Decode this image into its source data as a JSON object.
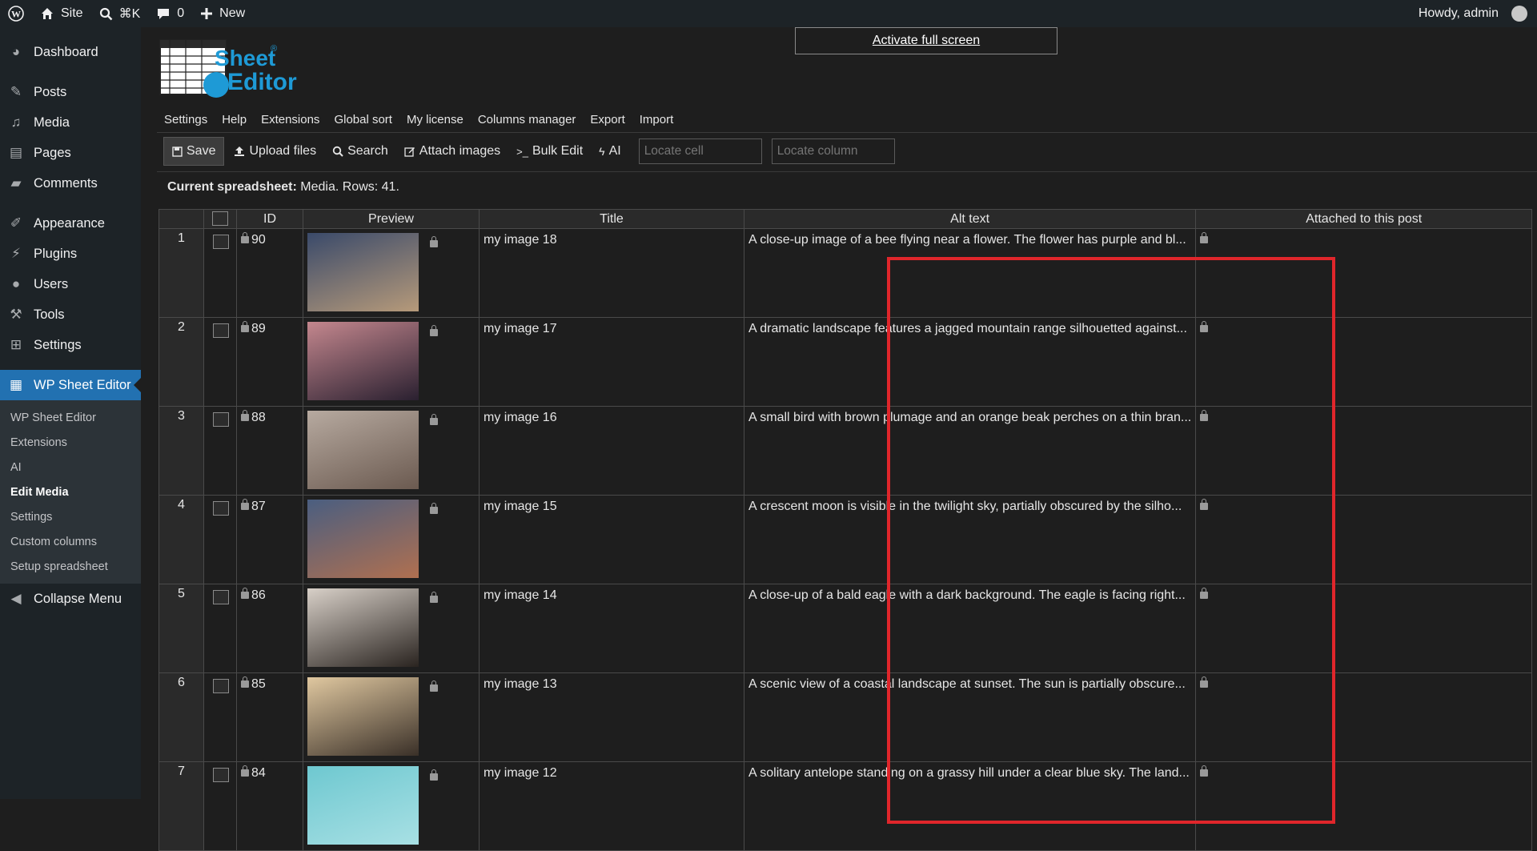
{
  "adminbar": {
    "site_label": "Site",
    "search_shortcut": "⌘K",
    "comments_count": "0",
    "new_label": "New",
    "greeting": "Howdy, admin"
  },
  "sidebar": {
    "items": [
      {
        "label": "Dashboard",
        "icon": "dashboard-icon"
      },
      {
        "label": "Posts",
        "icon": "pin-icon"
      },
      {
        "label": "Media",
        "icon": "media-icon"
      },
      {
        "label": "Pages",
        "icon": "pages-icon"
      },
      {
        "label": "Comments",
        "icon": "comment-icon"
      },
      {
        "label": "Appearance",
        "icon": "brush-icon"
      },
      {
        "label": "Plugins",
        "icon": "plug-icon"
      },
      {
        "label": "Users",
        "icon": "user-icon"
      },
      {
        "label": "Tools",
        "icon": "wrench-icon"
      },
      {
        "label": "Settings",
        "icon": "settings-icon"
      },
      {
        "label": "WP Sheet Editor",
        "icon": "sheet-icon"
      }
    ],
    "submenu": [
      "WP Sheet Editor",
      "Extensions",
      "AI",
      "Edit Media",
      "Settings",
      "Custom columns",
      "Setup spreadsheet"
    ],
    "collapse_label": "Collapse Menu"
  },
  "header": {
    "logo_text_top": "Sheet",
    "logo_text_bottom": "Editor",
    "logo_mark": "®",
    "fullscreen_label": "Activate full screen"
  },
  "topnav": [
    "Settings",
    "Help",
    "Extensions",
    "Global sort",
    "My license",
    "Columns manager",
    "Export",
    "Import"
  ],
  "toolbar": {
    "save": "Save",
    "upload": "Upload files",
    "search": "Search",
    "attach": "Attach images",
    "bulk": "Bulk Edit",
    "ai": "AI",
    "locate_cell_placeholder": "Locate cell",
    "locate_column_placeholder": "Locate column"
  },
  "status": {
    "prefix": "Current spreadsheet:",
    "text": "Media. Rows: 41."
  },
  "grid": {
    "headers": [
      "",
      "",
      "ID",
      "Preview",
      "Title",
      "Alt text",
      "Attached to this post"
    ],
    "rows": [
      {
        "num": "1",
        "id": "90",
        "title": "my image 18",
        "alt": "A close-up image of a bee flying near a flower. The flower has purple and bl...",
        "thumb_colors": [
          "#3a4a6a",
          "#b69a7a"
        ]
      },
      {
        "num": "2",
        "id": "89",
        "title": "my image 17",
        "alt": "A dramatic landscape features a jagged mountain range silhouetted against...",
        "thumb_colors": [
          "#c4878e",
          "#2a2030"
        ]
      },
      {
        "num": "3",
        "id": "88",
        "title": "my image 16",
        "alt": "A small bird with brown plumage and an orange beak perches on a thin bran...",
        "thumb_colors": [
          "#b7aaa0",
          "#6b5a50"
        ]
      },
      {
        "num": "4",
        "id": "87",
        "title": "my image 15",
        "alt": "A crescent moon is visible in the twilight sky, partially obscured by the silho...",
        "thumb_colors": [
          "#4a5e80",
          "#b07050"
        ]
      },
      {
        "num": "5",
        "id": "86",
        "title": "my image 14",
        "alt": "A close-up of a bald eagle with a dark background. The eagle is facing right...",
        "thumb_colors": [
          "#d8d0c8",
          "#2a2420"
        ]
      },
      {
        "num": "6",
        "id": "85",
        "title": "my image 13",
        "alt": "A scenic view of a coastal landscape at sunset. The sun is partially obscure...",
        "thumb_colors": [
          "#e0c8a0",
          "#3a3028"
        ]
      },
      {
        "num": "7",
        "id": "84",
        "title": "my image 12",
        "alt": "A solitary antelope standing on a grassy hill under a clear blue sky. The land...",
        "thumb_colors": [
          "#6ec8d0",
          "#a8e0e4"
        ]
      }
    ]
  },
  "colors": {
    "accent": "#2271b1",
    "highlight": "#e0262b",
    "logo_blue": "#1e9ad6"
  }
}
